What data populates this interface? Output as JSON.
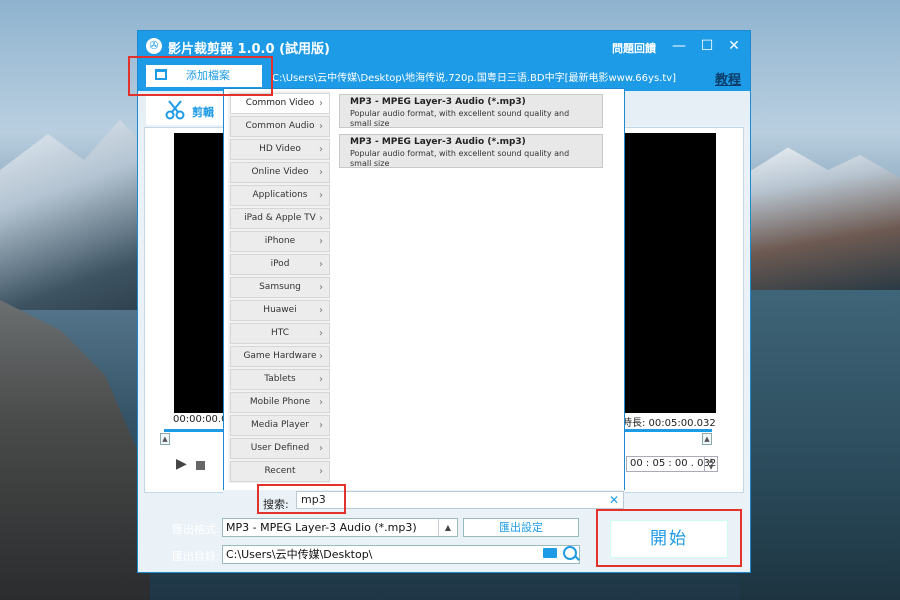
{
  "window": {
    "title": "影片裁剪器 1.0.0 (試用版)",
    "feedback_label": "問題回饋",
    "minimize": "—",
    "maximize": "☐",
    "close": "✕"
  },
  "toolbar": {
    "add_file_label": "添加檔案",
    "file_path": "C:\\Users\\云中传媒\\Desktop\\地海传说.720p.国粤日三语.BD中字[最新电影www.66ys.tv]",
    "tutorial_label": "教程"
  },
  "tabs": {
    "cut_label": "剪輯"
  },
  "player": {
    "time_start": "00:00:00.000",
    "duration_label": "時長: 00:05:00.032",
    "end_time": "00 : 05 : 00 . 032"
  },
  "format_panel": {
    "categories": [
      "Common Video",
      "Common Audio",
      "HD Video",
      "Online Video",
      "Applications",
      "iPad & Apple TV",
      "iPhone",
      "iPod",
      "Samsung",
      "Huawei",
      "HTC",
      "Game Hardware",
      "Tablets",
      "Mobile Phone",
      "Media Player",
      "User Defined",
      "Recent"
    ],
    "active_category": "Common Video",
    "formats": [
      {
        "title": "MP3 - MPEG Layer-3 Audio (*.mp3)",
        "desc": "Popular audio format, with excellent sound quality and small size"
      },
      {
        "title": "MP3 - MPEG Layer-3 Audio (*.mp3)",
        "desc": "Popular audio format, with excellent sound quality and small size"
      }
    ],
    "search_label": "搜索:",
    "search_value": "mp3"
  },
  "output": {
    "format_label": "匯出格式:",
    "format_value": "MP3 - MPEG Layer-3 Audio (*.mp3)",
    "settings_label": "匯出設定",
    "dir_label": "匯出目錄:",
    "dir_value": "C:\\Users\\云中传媒\\Desktop\\"
  },
  "start_label": "開始",
  "colors": {
    "accent": "#1e9be6",
    "highlight": "#e2322b"
  }
}
